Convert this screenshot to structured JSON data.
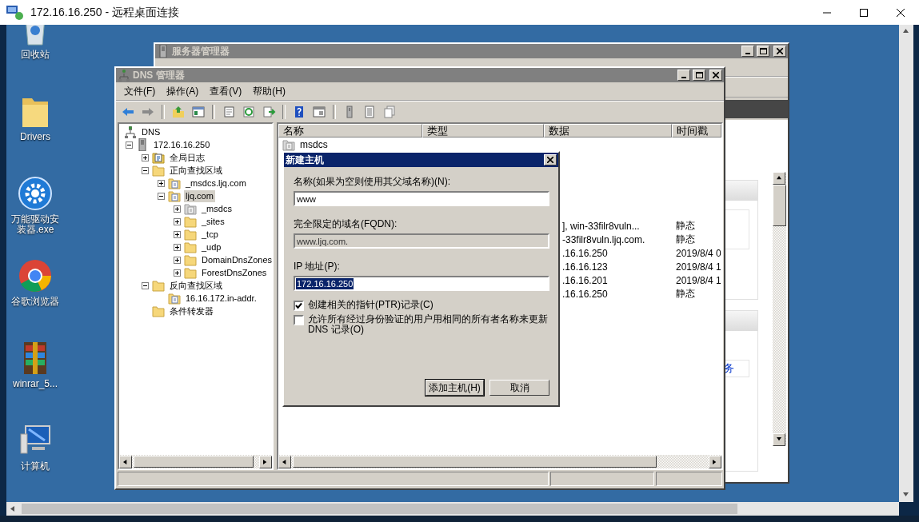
{
  "rdp_window": {
    "title": "172.16.16.250 - 远程桌面连接"
  },
  "desktop_icons": [
    {
      "label": "回收站",
      "kind": "recycle-bin"
    },
    {
      "label": "Drivers",
      "kind": "folder"
    },
    {
      "label": "万能驱动安装器.exe",
      "kind": "gear"
    },
    {
      "label": "谷歌浏览器",
      "kind": "browser"
    },
    {
      "label": "winrar_5...",
      "kind": "archive"
    },
    {
      "label": "计算机",
      "kind": "computer"
    }
  ],
  "server_manager": {
    "title": "服务器管理器",
    "active": false,
    "link": "务"
  },
  "dns_manager": {
    "title": "DNS 管理器",
    "active": false,
    "menu": [
      "文件(F)",
      "操作(A)",
      "查看(V)",
      "帮助(H)"
    ],
    "tree": [
      {
        "label": "DNS",
        "kind": "dns",
        "selected": false,
        "children": [
          {
            "label": "172.16.16.250",
            "kind": "server",
            "expanded": true,
            "selected": false,
            "children": [
              {
                "label": "全局日志",
                "kind": "log",
                "expanded": false,
                "selected": false
              },
              {
                "label": "正向查找区域",
                "kind": "folder",
                "expanded": true,
                "selected": false,
                "children": [
                  {
                    "label": "_msdcs.ljq.com",
                    "kind": "zone",
                    "expanded": false,
                    "selected": false
                  },
                  {
                    "label": "ljq.com",
                    "kind": "zone",
                    "expanded": true,
                    "selected": true,
                    "children": [
                      {
                        "label": "_msdcs",
                        "kind": "zone-gray",
                        "expanded": false,
                        "selected": false
                      },
                      {
                        "label": "_sites",
                        "kind": "folder",
                        "expanded": false,
                        "selected": false
                      },
                      {
                        "label": "_tcp",
                        "kind": "folder",
                        "expanded": false,
                        "selected": false
                      },
                      {
                        "label": "_udp",
                        "kind": "folder",
                        "expanded": false,
                        "selected": false
                      },
                      {
                        "label": "DomainDnsZones",
                        "kind": "folder",
                        "expanded": false,
                        "selected": false
                      },
                      {
                        "label": "ForestDnsZones",
                        "kind": "folder",
                        "expanded": false,
                        "selected": false
                      }
                    ]
                  }
                ]
              },
              {
                "label": "反向查找区域",
                "kind": "folder",
                "expanded": true,
                "selected": false,
                "children": [
                  {
                    "label": "16.16.172.in-addr.",
                    "kind": "zone",
                    "selected": false
                  }
                ]
              },
              {
                "label": "条件转发器",
                "kind": "folder",
                "selected": false
              }
            ]
          }
        ]
      }
    ],
    "list": {
      "columns": [
        "名称",
        "类型",
        "数据",
        "时间戳"
      ],
      "rows": [
        {
          "name": "msdcs"
        },
        {
          "data": "], win-33filr8vuln...",
          "timestamp": "静态"
        },
        {
          "data": "-33filr8vuln.ljq.com.",
          "timestamp": "静态"
        },
        {
          "data": ".16.16.250",
          "timestamp": "2019/8/4 0"
        },
        {
          "data": ".16.16.123",
          "timestamp": "2019/8/4 1"
        },
        {
          "data": ".16.16.201",
          "timestamp": "2019/8/4 1"
        },
        {
          "data": ".16.16.250",
          "timestamp": "静态"
        }
      ]
    }
  },
  "dialog": {
    "title": "新建主机",
    "active": true,
    "fields": [
      {
        "label": "名称(如果为空则使用其父域名称)(N):",
        "value": "www",
        "disabled": false,
        "highlighted": false
      },
      {
        "label": "完全限定的域名(FQDN):",
        "value": "www.ljq.com.",
        "disabled": true,
        "highlighted": false
      },
      {
        "label": "IP 地址(P):",
        "value": "172.16.16.250",
        "disabled": false,
        "highlighted": true
      }
    ],
    "options": [
      {
        "label": "创建相关的指针(PTR)记录(C)",
        "checked": true
      },
      {
        "label": "允许所有经过身份验证的用户用相同的所有者名称来更新DNS 记录(O)",
        "checked": false
      }
    ],
    "buttons": [
      {
        "label": "添加主机(H)",
        "default": true
      },
      {
        "label": "取消",
        "default": false
      }
    ]
  }
}
